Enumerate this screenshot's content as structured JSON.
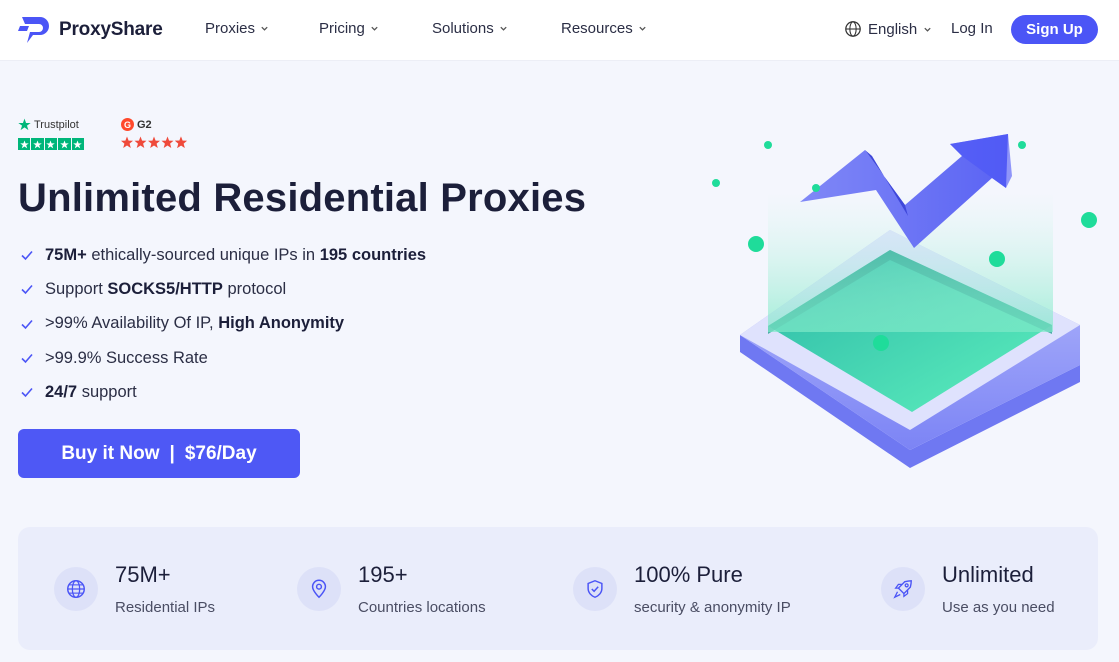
{
  "header": {
    "brand": "ProxyShare",
    "nav": [
      {
        "label": "Proxies"
      },
      {
        "label": "Pricing"
      },
      {
        "label": "Solutions"
      },
      {
        "label": "Resources"
      }
    ],
    "language": "English",
    "login": "Log In",
    "signup": "Sign Up"
  },
  "ratings": {
    "trustpilot": {
      "name": "Trustpilot",
      "stars": 5
    },
    "g2": {
      "name": "G2",
      "stars": 4.5
    }
  },
  "hero": {
    "title": "Unlimited Residential Proxies",
    "features": [
      {
        "parts": [
          {
            "t": "75M+",
            "b": true
          },
          {
            "t": " ethically-sourced unique IPs in ",
            "b": false
          },
          {
            "t": "195 countries",
            "b": true
          }
        ]
      },
      {
        "parts": [
          {
            "t": "Support ",
            "b": false
          },
          {
            "t": "SOCKS5/HTTP",
            "b": true
          },
          {
            "t": " protocol",
            "b": false
          }
        ]
      },
      {
        "parts": [
          {
            "t": ">99% Availability Of IP, ",
            "b": false
          },
          {
            "t": "High Anonymity",
            "b": true
          }
        ]
      },
      {
        "parts": [
          {
            "t": ">99.9% Success Rate",
            "b": false
          }
        ]
      },
      {
        "parts": [
          {
            "t": "24/7",
            "b": true
          },
          {
            "t": " support",
            "b": false
          }
        ]
      }
    ],
    "buy_label": "Buy it Now",
    "buy_separator": "|",
    "buy_price": "$76/Day"
  },
  "stats": [
    {
      "icon": "globe-icon",
      "value": "75M+",
      "label": "Residential IPs"
    },
    {
      "icon": "location-pin-icon",
      "value": "195+",
      "label": "Countries locations"
    },
    {
      "icon": "shield-check-icon",
      "value": "100% Pure",
      "label": "security & anonymity IP"
    },
    {
      "icon": "rocket-icon",
      "value": "Unlimited",
      "label": "Use as you need"
    }
  ],
  "colors": {
    "accent": "#4b55f6",
    "trustpilot_green": "#00b67a",
    "g2_red": "#ef4a3b",
    "mint": "#1fdc9a"
  }
}
